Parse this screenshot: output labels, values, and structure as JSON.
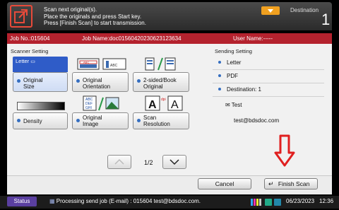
{
  "header": {
    "messages": [
      "Scan next original(s).",
      "Place the originals and press Start key.",
      "Press [Finish Scan] to start transmission."
    ],
    "destination_label": "Destination",
    "destination_count": "1"
  },
  "jobbar": {
    "job_no": "Job No.:015604",
    "job_name": "Job Name:doc01560420230623123634",
    "user_name": "User Name:-----"
  },
  "scanner": {
    "title": "Scanner Setting",
    "original_size_selected": "Letter",
    "buttons": {
      "original_size": [
        "Original",
        "Size"
      ],
      "original_orientation": [
        "Original",
        "Orientation"
      ],
      "two_sided": [
        "2-sided/Book",
        "Original"
      ],
      "density": [
        "Density"
      ],
      "original_image": [
        "Original",
        "Image"
      ],
      "scan_resolution": [
        "Scan",
        "Resolution"
      ]
    },
    "icon_text": {
      "abc": "ABC",
      "def": "DEF",
      "ghi": "GHI",
      "dpi": "dpi",
      "a": "A"
    }
  },
  "sending": {
    "title": "Sending Setting",
    "items": [
      "Letter",
      "PDF",
      "Destination: 1"
    ],
    "dest_name": "Test",
    "dest_email": "test@bdsdoc.com"
  },
  "pager": {
    "indicator": "1/2"
  },
  "actions": {
    "cancel": "Cancel",
    "finish": "Finish Scan"
  },
  "status": {
    "button": "Status",
    "message": "Processing send job (E-mail) : 015604 test@bdsdoc.com.",
    "date": "06/23/2023",
    "time": "12:36"
  },
  "colors": {
    "job_bar": "#b4222e",
    "accent_blue": "#2f5cc8",
    "arrow_red": "#e02020",
    "dest_tab": "#f0a020"
  }
}
